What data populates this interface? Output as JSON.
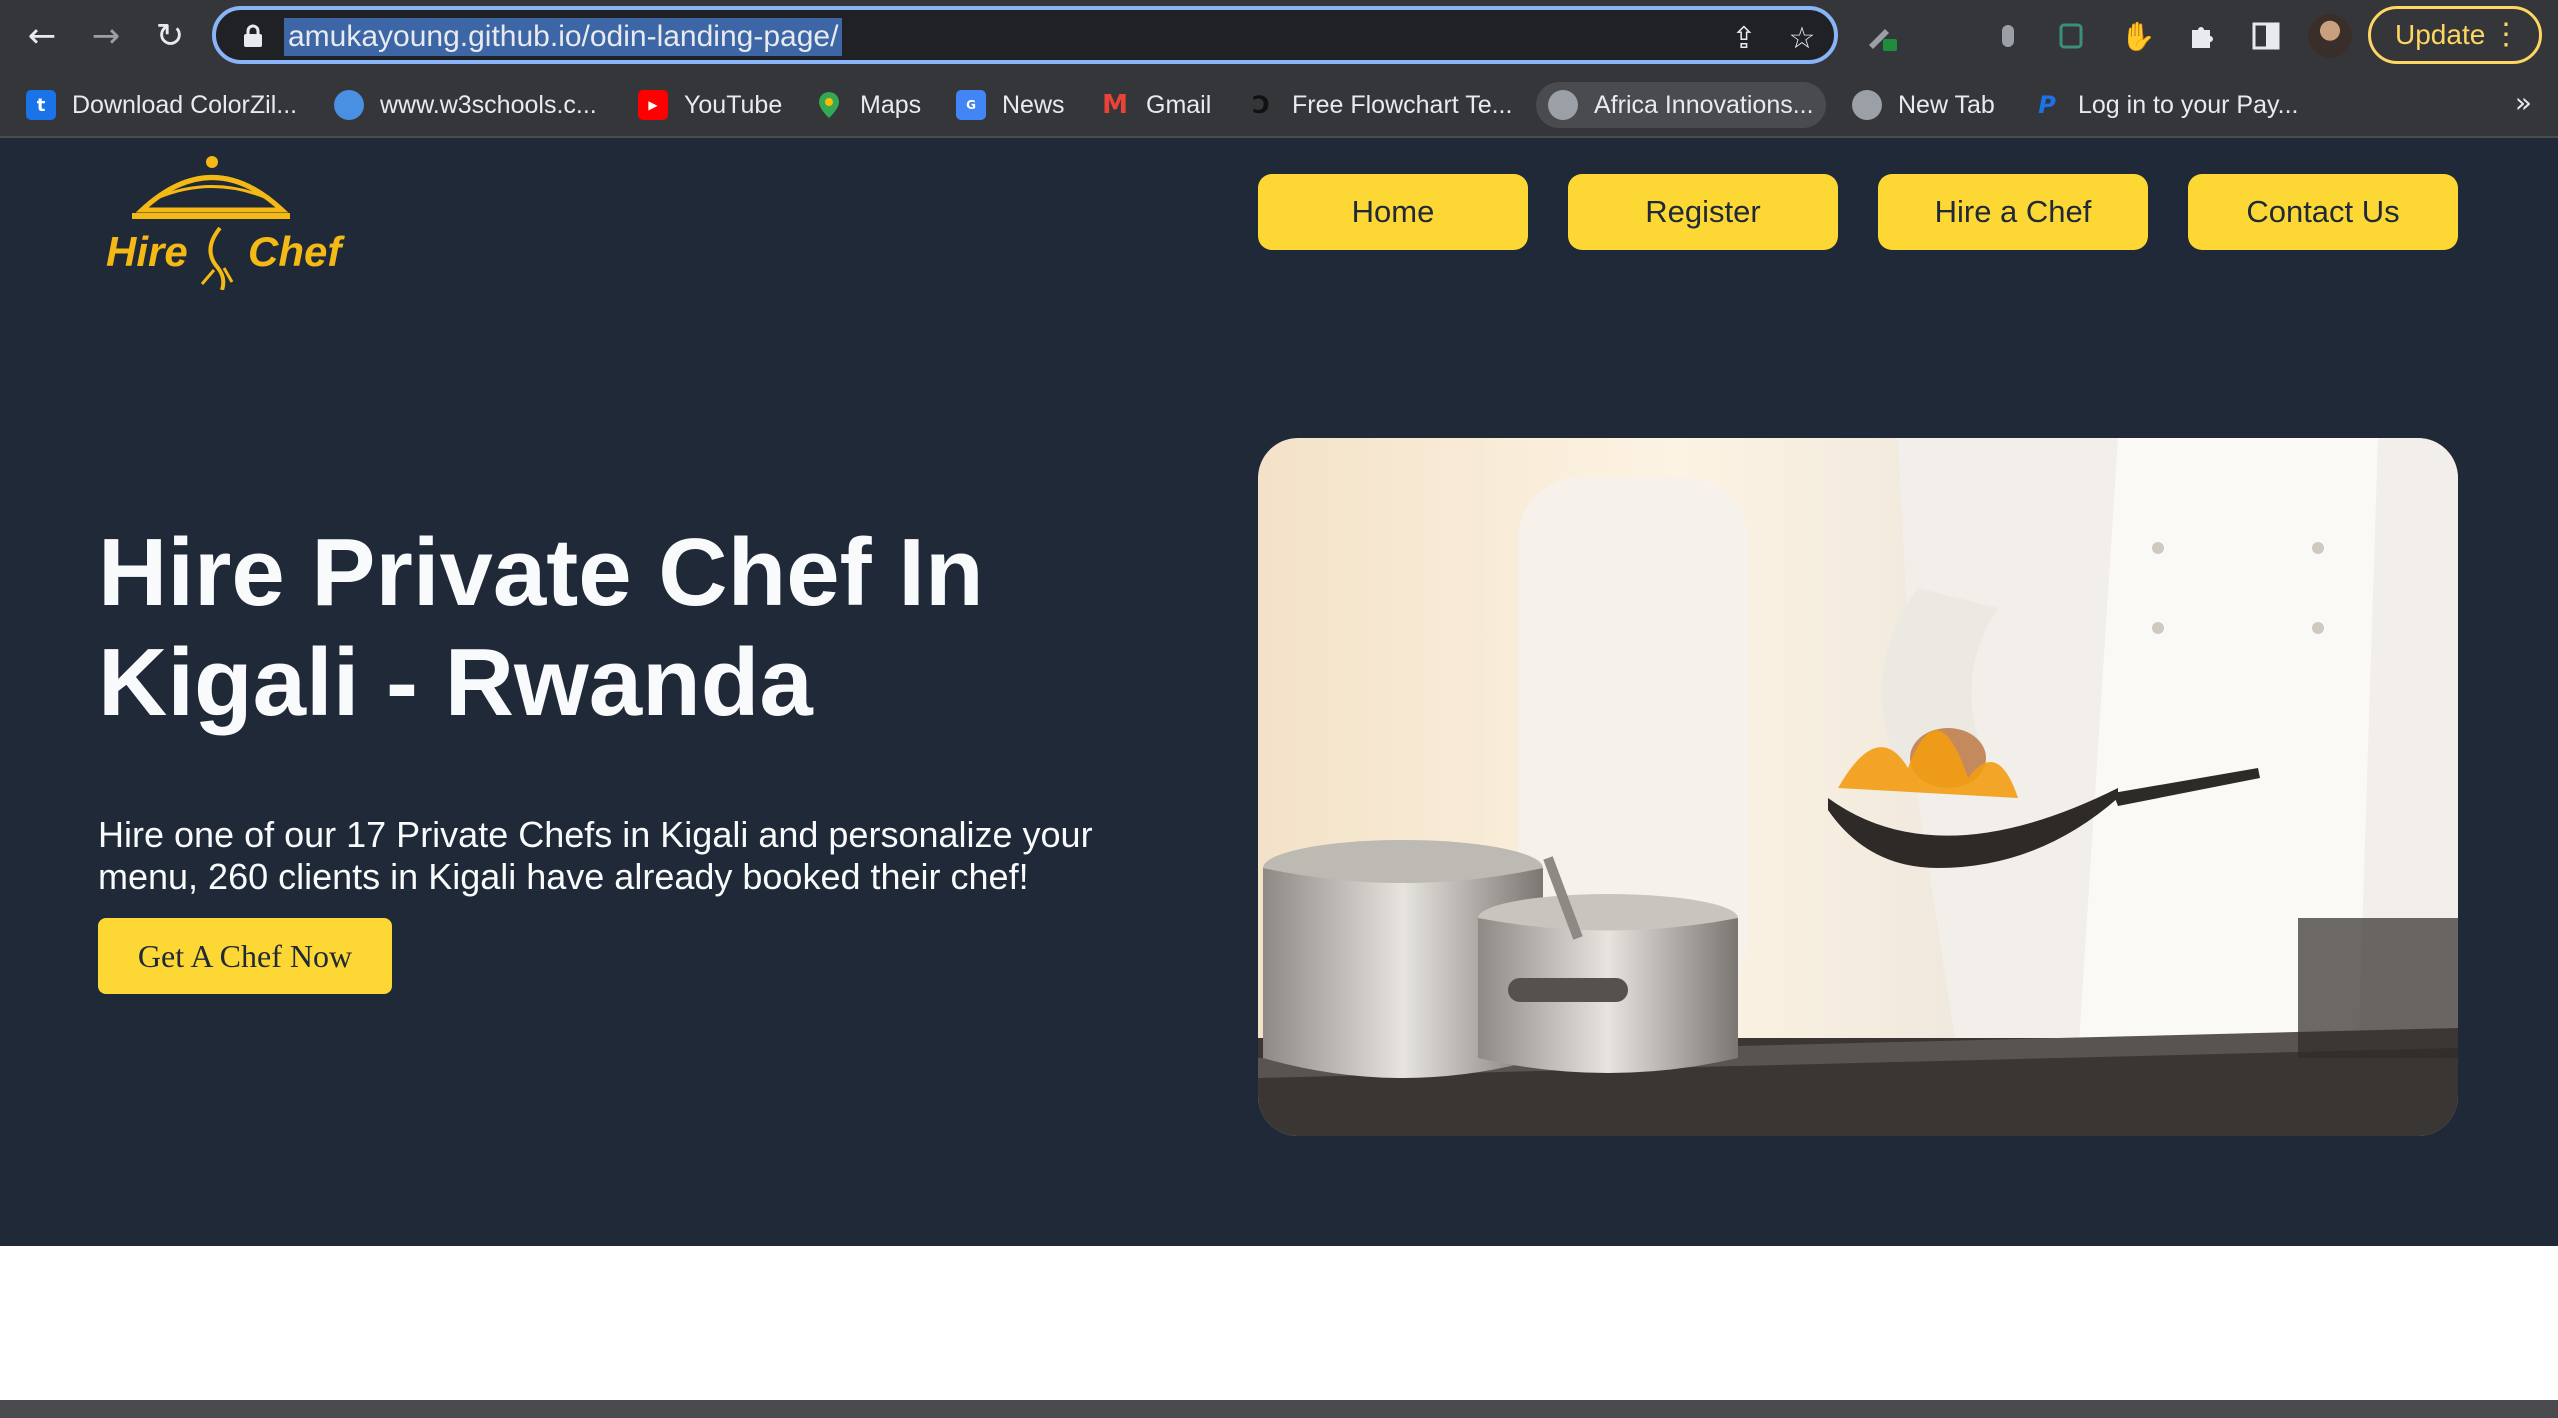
{
  "browser": {
    "url": "amukayoung.github.io/odin-landing-page/",
    "update_label": "Update",
    "back_icon": "back-arrow-icon",
    "forward_icon": "forward-arrow-icon",
    "reload_icon": "reload-icon"
  },
  "bookmarks": {
    "items": [
      {
        "label": "Download ColorZil...",
        "icon": "colorzilla-icon",
        "color": "#1a73e8"
      },
      {
        "label": "www.w3schools.c...",
        "icon": "w3schools-icon",
        "color": "#4a90e2"
      },
      {
        "label": "YouTube",
        "icon": "youtube-icon",
        "color": "#ff0000"
      },
      {
        "label": "Maps",
        "icon": "maps-icon",
        "color": "#34a853"
      },
      {
        "label": "News",
        "icon": "news-icon",
        "color": "#4285f4"
      },
      {
        "label": "Gmail",
        "icon": "gmail-icon",
        "color": "#ea4335"
      },
      {
        "label": "Free Flowchart Te...",
        "icon": "flowchart-icon",
        "color": "#111111"
      },
      {
        "label": "Africa Innovations...",
        "icon": "globe-icon",
        "color": "#9aa0a6"
      },
      {
        "label": "New Tab",
        "icon": "globe-icon",
        "color": "#9aa0a6"
      },
      {
        "label": "Log in to your Pay...",
        "icon": "paypal-icon",
        "color": "#003087"
      }
    ],
    "more": "»"
  },
  "site": {
    "logo_text_left": "Hire",
    "logo_text_right": "Chef",
    "nav": {
      "home": "Home",
      "register": "Register",
      "hire": "Hire a Chef",
      "contact": "Contact Us"
    },
    "hero": {
      "title": "Hire Private Chef In Kigali - Rwanda",
      "text": "Hire one of our 17 Private Chefs in Kigali and personalize your menu, 260 clients in Kigali have already booked their chef!",
      "cta": "Get A Chef Now"
    }
  },
  "colors": {
    "page_bg": "#1f2937",
    "accent": "#fdd835",
    "chrome": "#35363a"
  }
}
